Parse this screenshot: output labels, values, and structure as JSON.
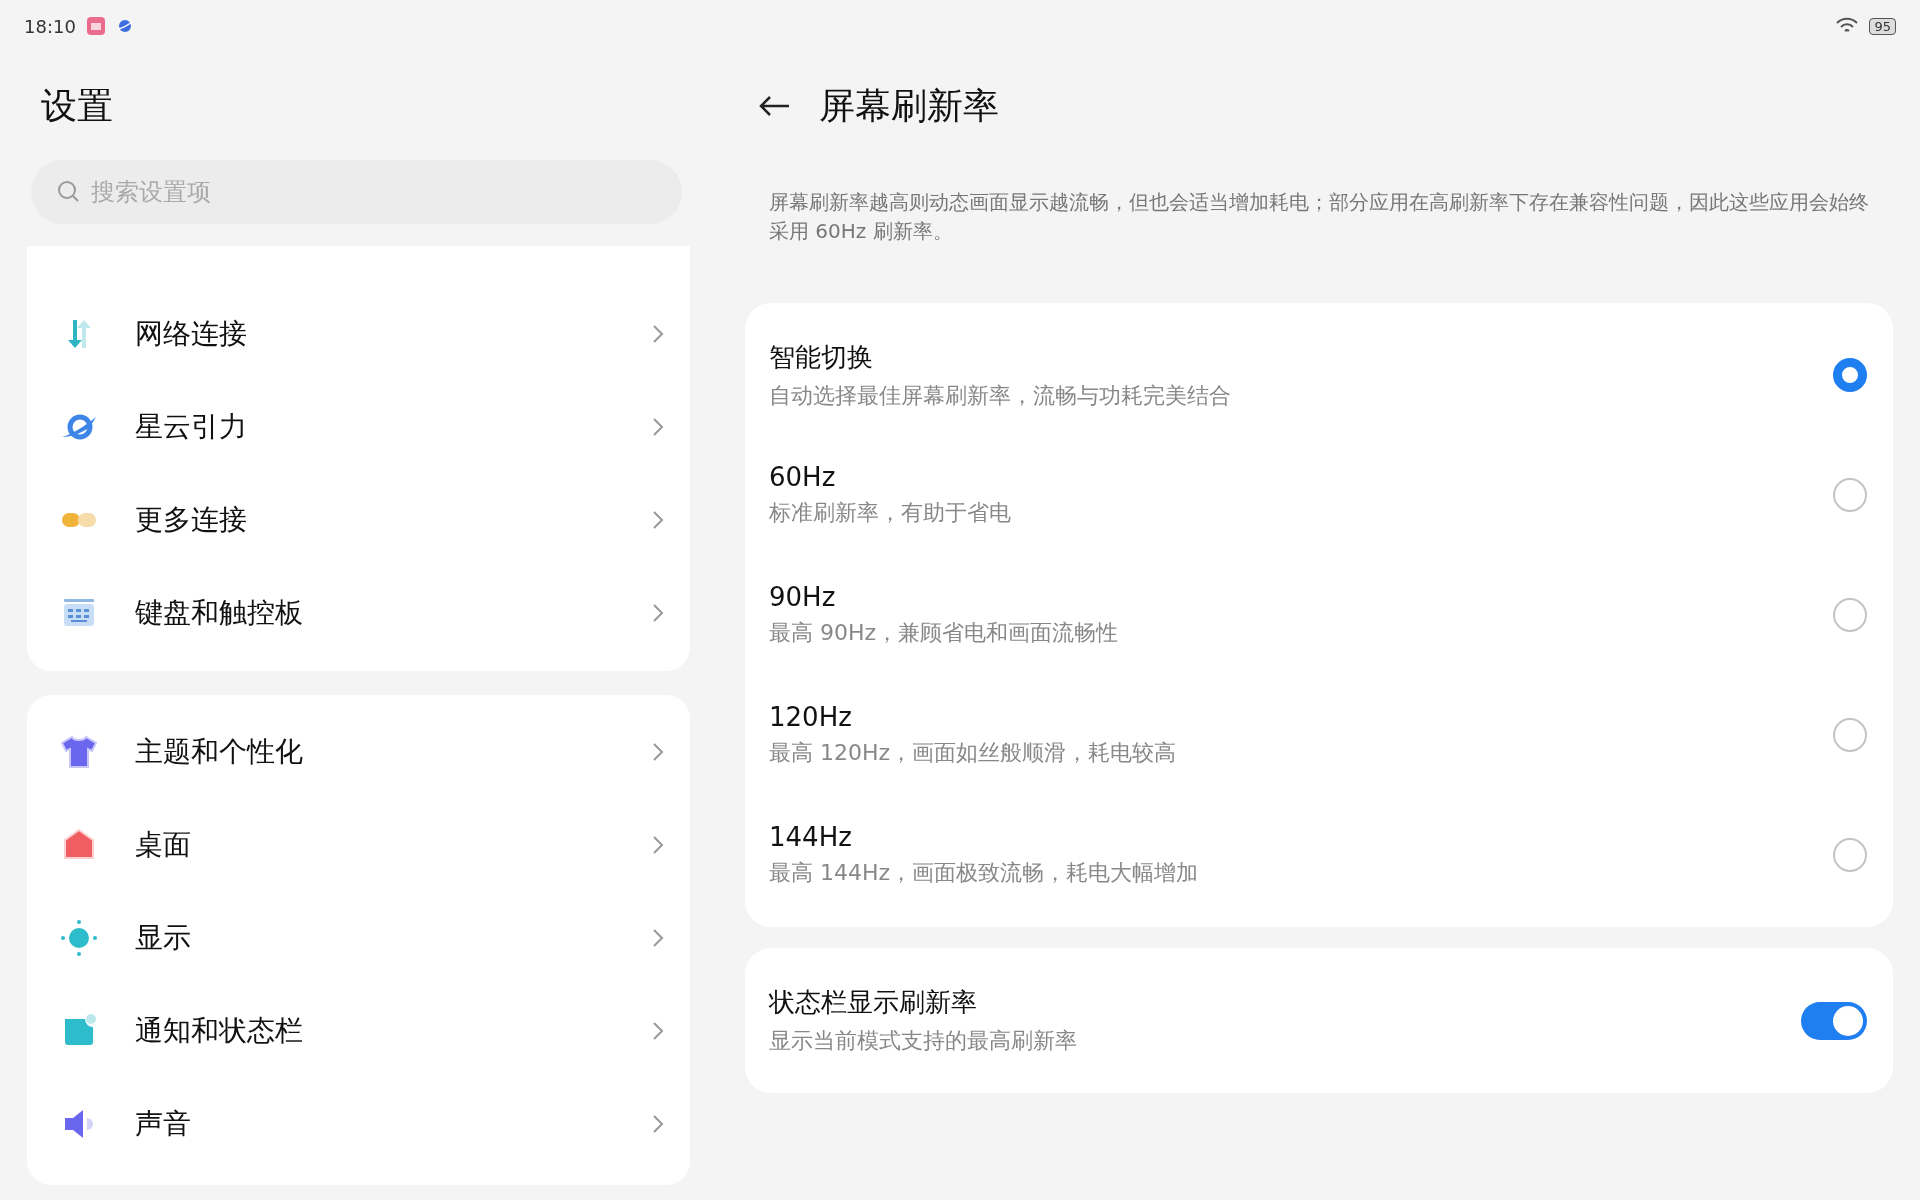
{
  "status_bar": {
    "time": "18:10",
    "battery": "95"
  },
  "sidebar": {
    "title": "设置",
    "search": {
      "placeholder": "搜索设置项"
    },
    "groups": [
      {
        "items": [
          {
            "label": "网络连接"
          },
          {
            "label": "星云引力"
          },
          {
            "label": "更多连接"
          },
          {
            "label": "键盘和触控板"
          }
        ]
      },
      {
        "items": [
          {
            "label": "主题和个性化"
          },
          {
            "label": "桌面"
          },
          {
            "label": "显示"
          },
          {
            "label": "通知和状态栏"
          },
          {
            "label": "声音"
          }
        ]
      }
    ]
  },
  "detail": {
    "title": "屏幕刷新率",
    "description": "屏幕刷新率越高则动态画面显示越流畅，但也会适当增加耗电；部分应用在高刷新率下存在兼容性问题，因此这些应用会始终采用 60Hz 刷新率。",
    "options": [
      {
        "title": "智能切换",
        "subtitle": "自动选择最佳屏幕刷新率，流畅与功耗完美结合",
        "selected": true
      },
      {
        "title": "60Hz",
        "subtitle": "标准刷新率，有助于省电",
        "selected": false
      },
      {
        "title": "90Hz",
        "subtitle": "最高 90Hz，兼顾省电和画面流畅性",
        "selected": false
      },
      {
        "title": "120Hz",
        "subtitle": "最高 120Hz，画面如丝般顺滑，耗电较高",
        "selected": false
      },
      {
        "title": "144Hz",
        "subtitle": "最高 144Hz，画面极致流畅，耗电大幅增加",
        "selected": false
      }
    ],
    "toggle": {
      "title": "状态栏显示刷新率",
      "subtitle": "显示当前模式支持的最高刷新率",
      "on": true
    }
  }
}
